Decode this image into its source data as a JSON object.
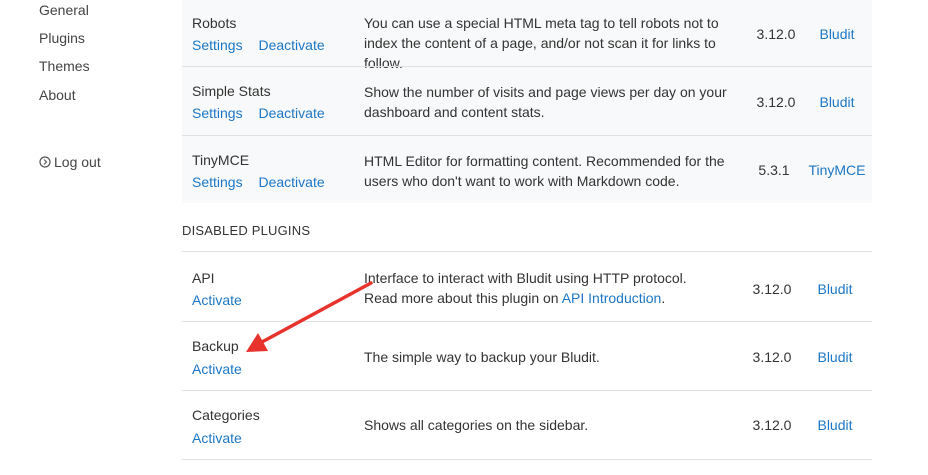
{
  "sidebar": {
    "items": [
      {
        "label": "General"
      },
      {
        "label": "Plugins"
      },
      {
        "label": "Themes"
      },
      {
        "label": "About"
      }
    ],
    "logout_label": "Log out"
  },
  "enabled_plugins": [
    {
      "name": "Robots",
      "settings_label": "Settings",
      "deactivate_label": "Deactivate",
      "description": "You can use a special HTML meta tag to tell robots not to index the content of a page, and/or not scan it for links to follow.",
      "version": "3.12.0",
      "author": "Bludit"
    },
    {
      "name": "Simple Stats",
      "settings_label": "Settings",
      "deactivate_label": "Deactivate",
      "description": "Show the number of visits and page views per day on your dashboard and content stats.",
      "version": "3.12.0",
      "author": "Bludit"
    },
    {
      "name": "TinyMCE",
      "settings_label": "Settings",
      "deactivate_label": "Deactivate",
      "description": "HTML Editor for formatting content. Recommended for the users who don't want to work with Markdown code.",
      "version": "5.3.1",
      "author": "TinyMCE"
    }
  ],
  "disabled_section_title": "DISABLED PLUGINS",
  "disabled_plugins": [
    {
      "name": "API",
      "activate_label": "Activate",
      "description_line1": "Interface to interact with Bludit using HTTP protocol.",
      "description_line2_prefix": "Read more about this plugin on ",
      "description_link": "API Introduction",
      "description_line2_suffix": ".",
      "version": "3.12.0",
      "author": "Bludit"
    },
    {
      "name": "Backup",
      "activate_label": "Activate",
      "description": "The simple way to backup your Bludit.",
      "version": "3.12.0",
      "author": "Bludit"
    },
    {
      "name": "Categories",
      "activate_label": "Activate",
      "description": "Shows all categories on the sidebar.",
      "version": "3.12.0",
      "author": "Bludit"
    }
  ],
  "colors": {
    "link": "#1d77c6",
    "annotation_arrow": "#e8322c",
    "enabled_row_background": "#f8f9fa"
  }
}
